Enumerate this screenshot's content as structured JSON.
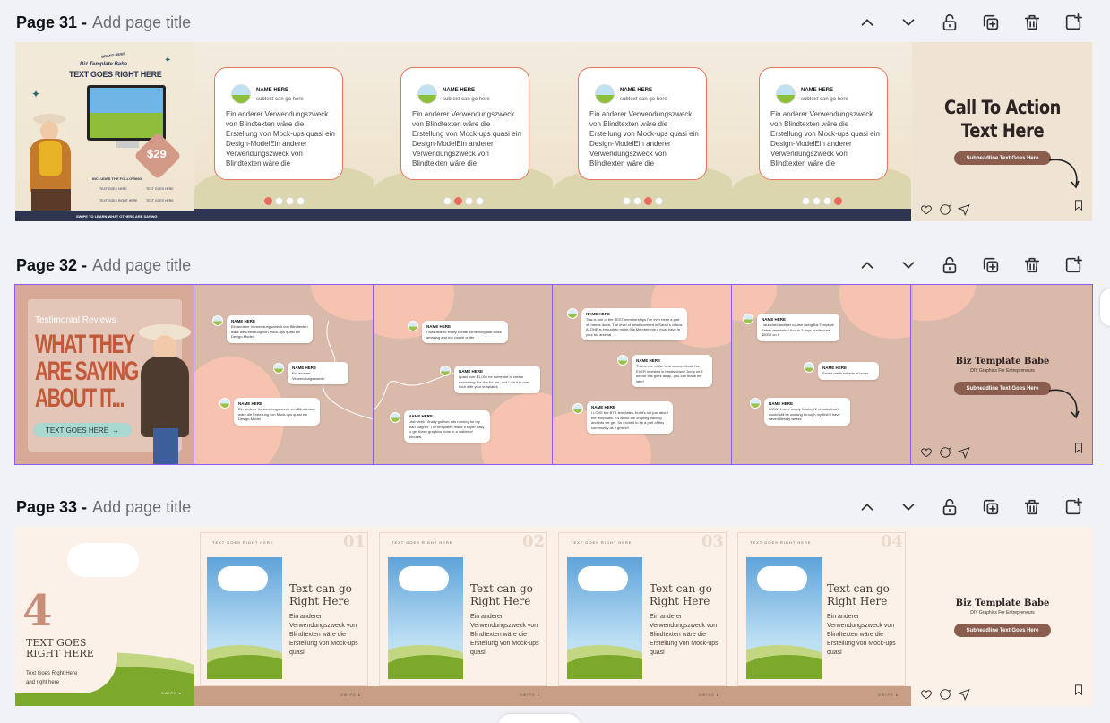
{
  "pages": [
    {
      "number": "Page 31",
      "title_placeholder": "Add page title",
      "slide1": {
        "badge": "BRAND NEW!",
        "brand": "Biz Template Babe",
        "headline": "TEXT GOES RIGHT HERE",
        "price": "$29",
        "includes": "INCLUDES THE FOLLOWING",
        "items": [
          "TEXT GOES HERE",
          "TEXT GOES HERE",
          "TEXT GOES RIGHT HERE",
          "TEXT GOES HERE"
        ],
        "swipe": "SWIPE TO LEARN WHAT OTHERS ARE SAYING"
      },
      "cards": [
        {
          "name": "NAME HERE",
          "sub": "subtext can go here",
          "body": "Ein anderer Verwendungszweck von Blindtexten wäre die Erstellung von Mock-ups quasi ein Design-ModelEin anderer Verwendungszweck von Blindtexten wäre die"
        },
        {
          "name": "NAME HERE",
          "sub": "subtext can go here",
          "body": "Ein anderer Verwendungszweck von Blindtexten wäre die Erstellung von Mock-ups quasi ein Design-ModelEin anderer Verwendungszweck von Blindtexten wäre die"
        },
        {
          "name": "NAME HERE",
          "sub": "subtext can go here",
          "body": "Ein anderer Verwendungszweck von Blindtexten wäre die Erstellung von Mock-ups quasi ein Design-ModelEin anderer Verwendungszweck von Blindtexten wäre die"
        },
        {
          "name": "NAME HERE",
          "sub": "subtext can go here",
          "body": "Ein anderer Verwendungszweck von Blindtexten wäre die Erstellung von Mock-ups quasi ein Design-ModelEin anderer Verwendungszweck von Blindtexten wäre die"
        }
      ],
      "cta": {
        "line1": "Call To Action",
        "line2": "Text Here",
        "pill": "Subheadline Text Goes Here"
      }
    },
    {
      "number": "Page 32",
      "title_placeholder": "Add page title",
      "slide1": {
        "label": "Testimonial Reviews",
        "headline1": "WHAT THEY",
        "headline2": "ARE SAYING",
        "headline3": "ABOUT IT...",
        "button": "TEXT GOES HERE"
      },
      "testimonials": [
        {
          "name": "NAME HERE",
          "body": "Ein anderer Verwendungszweck von Blindtexten wäre die Erstellung von Mock-ups quasi ein Design-Model"
        },
        {
          "name": "NAME HERE",
          "body": "Ein anderer Verwendungszweck!"
        },
        {
          "name": "NAME HERE",
          "body": "Ein anderer Verwendungszweck von Blindtexten wäre die Erstellung von Mock-ups quasi ein Design-Model"
        },
        {
          "name": "NAME HERE",
          "body": "I was able to finally create something that looks amazing and not cookie cutter"
        },
        {
          "name": "NAME HERE",
          "body": "I paid over $1,000 for someone to create something like this for me, and I did it in one hour with your templates"
        },
        {
          "name": "NAME HERE",
          "body": "Last week I finally got two ads running for my lead Magnet. The templates made it super easy to get these graphics done in a matter of minutes."
        },
        {
          "name": "NAME HERE",
          "body": "This is one of the BEST memberships I've ever been a part of, hands down. The level of detail covered in Sarah's videos ALONE is enough to make this Membership a must have in your biz arsenal"
        },
        {
          "name": "NAME HERE",
          "body": "This is one of the best courses/tools I've EVER invested in hands down! Jump on it before this goes away...you can thank me later!"
        },
        {
          "name": "NAME HERE",
          "body": "I LOVE the BTB templates, but it's not just about the templates. It's about the ongoing training and info we get. So excited to be a part of this community as it grows!!"
        },
        {
          "name": "NAME HERE",
          "body": "I launched another course using Biz Template Babes templates! And in 3 days made over $5000 on it"
        },
        {
          "name": "NAME HERE",
          "body": "Saved me hundreds of hours"
        },
        {
          "name": "NAME HERE",
          "body": "WOW! I have nearly finished 2 ebooks that I would still be working through my first! I have saved literally weeks"
        }
      ],
      "cta": {
        "brand": "Biz Template Babe",
        "tagline": "DIY Graphics For Entrepreneurs",
        "pill": "Subheadline Text Goes Here"
      }
    },
    {
      "number": "Page 33",
      "title_placeholder": "Add page title",
      "slide1": {
        "number": "4",
        "headline1": "TEXT GOES",
        "headline2": "RIGHT HERE",
        "sub1": "Text Goes Right Here",
        "sub2": "and right here",
        "swipe": "SWIPE ▸"
      },
      "steps": [
        {
          "label": "TEXT GOES RIGHT HERE",
          "num": "01",
          "title1": "Text can go",
          "title2": "Right Here",
          "body": "Ein anderer Verwendungszweck von Blindtexten wäre die Erstellung von Mock-ups quasi",
          "swipe": "SWIPE ▸"
        },
        {
          "label": "TEXT GOES RIGHT HERE",
          "num": "02",
          "title1": "Text can go",
          "title2": "Right Here",
          "body": "Ein anderer Verwendungszweck von Blindtexten wäre die Erstellung von Mock-ups quasi",
          "swipe": "SWIPE ▸"
        },
        {
          "label": "TEXT GOES RIGHT HERE",
          "num": "03",
          "title1": "Text can go",
          "title2": "Right Here",
          "body": "Ein anderer Verwendungszweck von Blindtexten wäre die Erstellung von Mock-ups quasi",
          "swipe": "SWIPE ▸"
        },
        {
          "label": "TEXT GOES RIGHT HERE",
          "num": "04",
          "title1": "Text can go",
          "title2": "Right Here",
          "body": "Ein anderer Verwendungszweck von Blindtexten wäre die Erstellung von Mock-ups quasi",
          "swipe": "SWIPE ▸"
        }
      ],
      "cta": {
        "brand": "Biz Template Babe",
        "tagline": "DIY Graphics For Entrepreneurs",
        "pill": "Subheadline Text Goes Here"
      }
    }
  ],
  "toolbar_icons": [
    "chevron-up-icon",
    "chevron-down-icon",
    "unlock-icon",
    "duplicate-icon",
    "trash-icon",
    "add-page-icon"
  ],
  "colors": {
    "accent_coral": "#e57762",
    "selection": "#8b5cf6",
    "navy": "#2d3550",
    "pill_brown": "#8a5d4e"
  }
}
